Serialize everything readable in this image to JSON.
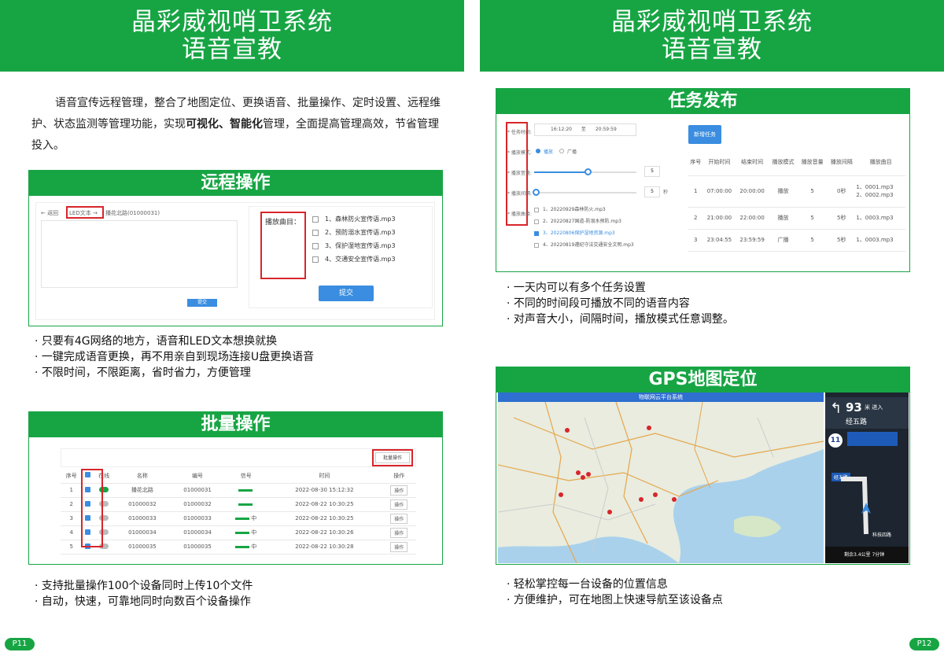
{
  "left_page": {
    "title_line1": "晶彩威视哨卫系统",
    "title_line2": "语音宣教",
    "intro_part1": "语音宣传远程管理，整合了地图定位、更换语音、批量操作、定时设置、远程维护、状态监测等管理功能，实现",
    "intro_bold": "可视化、智能化",
    "intro_part2": "管理，全面提高管理高效，节省管理投入。",
    "remote": {
      "header": "远程操作",
      "screenshot": {
        "back": "← 返回",
        "led_tab": "LED文本 →",
        "device_name": "播花北路(01000031)",
        "submit_small": "提交",
        "playlist_label": "播放曲目：",
        "tracks": [
          "1、森林防火宣传语.mp3",
          "2、预防溺水宣传语.mp3",
          "3、保护湿地宣传语.mp3",
          "4、交通安全宣传语.mp3"
        ],
        "submit": "提交"
      },
      "bullets": [
        "· 只要有4G网络的地方，语音和LED文本想换就换",
        "· 一键完成语音更换，再不用亲自到现场连接U盘更换语音",
        "· 不限时间，不限距离，省时省力，方便管理"
      ]
    },
    "batch": {
      "header": "批量操作",
      "screenshot": {
        "batch_btn": "批量操作",
        "columns": [
          "序号",
          "",
          "在线",
          "名称",
          "编号",
          "信号",
          "时间",
          "操作"
        ],
        "rows": [
          {
            "no": "1",
            "name": "播花北路",
            "code": "01000031",
            "signal": "",
            "time": "2022-08-30 15:12:32",
            "op": "操作"
          },
          {
            "no": "2",
            "name": "01000032",
            "code": "01000032",
            "signal": "",
            "time": "2022-08-22 10:30:25",
            "op": "操作"
          },
          {
            "no": "3",
            "name": "01000033",
            "code": "01000033",
            "signal": "中",
            "time": "2022-08-22 10:30:25",
            "op": "操作"
          },
          {
            "no": "4",
            "name": "01000034",
            "code": "01000034",
            "signal": "中",
            "time": "2022-08-22 10:30:26",
            "op": "操作"
          },
          {
            "no": "5",
            "name": "01000035",
            "code": "01000035",
            "signal": "中",
            "time": "2022-08-22 10:30:28",
            "op": "操作"
          }
        ]
      },
      "bullets": [
        "· 支持批量操作100个设备同时上传10个文件",
        "· 自动，快速，可靠地同时向数百个设备操作"
      ]
    },
    "page_num": "P11"
  },
  "right_page": {
    "title_line1": "晶彩威视哨卫系统",
    "title_line2": "语音宣教",
    "task": {
      "header": "任务发布",
      "form": {
        "time_label": "* 任务时间:",
        "start": "16:12:20",
        "to": "至",
        "end": "20:59:59",
        "mode_label": "* 播放模式:",
        "mode_a": "播放",
        "mode_b": "广播",
        "volume_label": "* 播放音量:",
        "volume_val": "5",
        "interval_label": "* 播放间隔:",
        "interval_val": "5",
        "interval_unit": "秒",
        "tracks_label": "* 播放曲目:",
        "tracks": [
          "1、20220929森林防火.mp3",
          "2、20220827国道-防溺水预防.mp3",
          "3、20220806保护湿地资源.mp3",
          "4、20220819遵纪守法交通安全文明.mp3"
        ]
      },
      "new_task": "新增任务",
      "columns": [
        "序号",
        "开始时间",
        "结束时间",
        "播放模式",
        "播放音量",
        "播放间隔",
        "播放曲目"
      ],
      "rows": [
        {
          "no": "1",
          "start": "07:00:00",
          "end": "20:00:00",
          "mode": "播放",
          "vol": "5",
          "gap": "0秒",
          "track": "1、0001.mp3\n2、0002.mp3"
        },
        {
          "no": "2",
          "start": "21:00:00",
          "end": "22:00:00",
          "mode": "播放",
          "vol": "5",
          "gap": "5秒",
          "track": "1、0003.mp3"
        },
        {
          "no": "3",
          "start": "23:04:55",
          "end": "23:59:59",
          "mode": "广播",
          "vol": "5",
          "gap": "5秒",
          "track": "1、0003.mp3"
        }
      ],
      "bullets": [
        "· 一天内可以有多个任务设置",
        "· 不同的时间段可播放不同的语音内容",
        "· 对声音大小，间隔时间，播放模式任意调整。"
      ]
    },
    "gps": {
      "header": "GPS地图定位",
      "map_title": "物联网云平台系统",
      "nav": {
        "distance": "93",
        "unit": "米 进入",
        "road": "经五路",
        "badge": "11",
        "road2": "经五路",
        "street": "科技四路",
        "remain": "剩余3.4公里 7分钟"
      },
      "bullets": [
        "· 轻松掌控每一台设备的位置信息",
        "· 方便维护，可在地图上快速导航至该设备点"
      ]
    },
    "page_num": "P12"
  },
  "colors": {
    "brand_green": "#17a544",
    "highlight_red": "#d7262b",
    "button_blue": "#3a8de0"
  }
}
